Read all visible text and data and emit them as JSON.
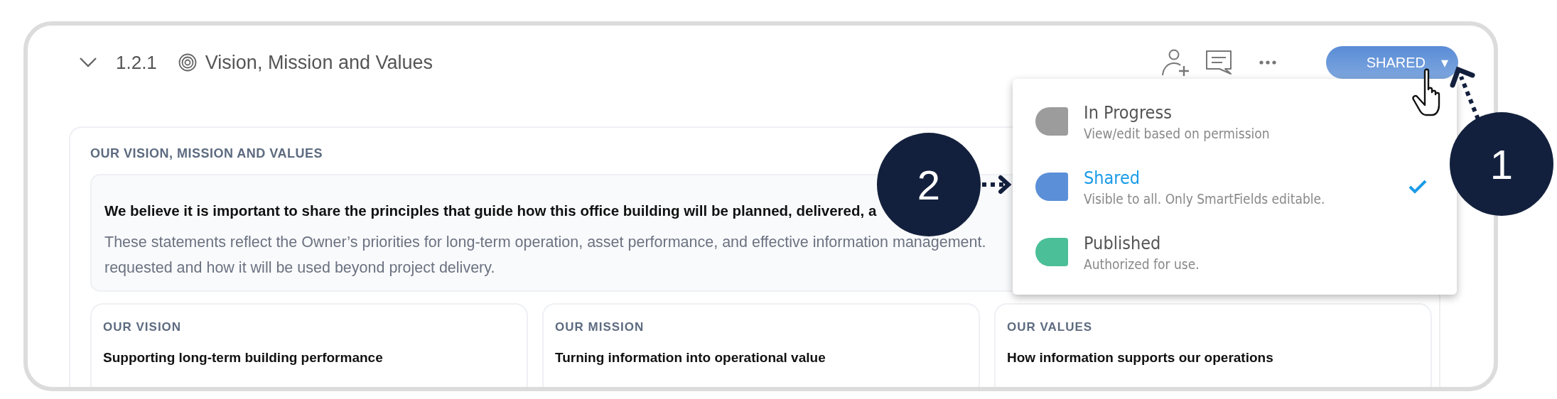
{
  "header": {
    "expanded": true,
    "number": "1.2.1",
    "title": "Vision, Mission and Values"
  },
  "status_button": {
    "label": "SHARED",
    "caret": "▾"
  },
  "status_menu": [
    {
      "title": "In Progress",
      "description": "View/edit based on permission",
      "color": "#9c9c9c",
      "selected": false
    },
    {
      "title": "Shared",
      "description": "Visible to all. Only SmartFields editable.",
      "color": "#5b8fd8",
      "selected": true
    },
    {
      "title": "Published",
      "description": "Authorized for use.",
      "color": "#4bbf98",
      "selected": false
    }
  ],
  "section": {
    "heading": "OUR VISION, MISSION AND VALUES",
    "statement": "We believe it is important to share the principles that guide how this office building will be planned, delivered, a",
    "description_lines": [
      "These statements reflect the Owner’s priorities for long-term operation, asset performance, and effective information management.",
      "requested and how it will be used beyond project delivery."
    ]
  },
  "cards": [
    {
      "label": "OUR VISION",
      "title": "Supporting long-term building performance"
    },
    {
      "label": "OUR MISSION",
      "title": "Turning information into operational value"
    },
    {
      "label": "OUR VALUES",
      "title": "How information supports our operations"
    }
  ],
  "callouts": [
    "1",
    "2"
  ]
}
